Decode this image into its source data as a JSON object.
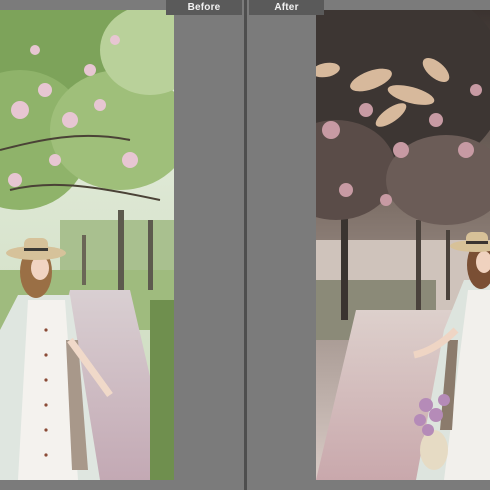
{
  "labels": {
    "before": "Before",
    "after": "After"
  },
  "colors": {
    "background": "#6e6e6e",
    "pane": "#7b7b7b",
    "divider": "#4e4e4e",
    "label_bg": "#5a5a5a",
    "label_text": "#f2f2f2"
  },
  "photos": {
    "before": {
      "icon": "photo-before-edit"
    },
    "after": {
      "icon": "photo-after-edit"
    }
  }
}
